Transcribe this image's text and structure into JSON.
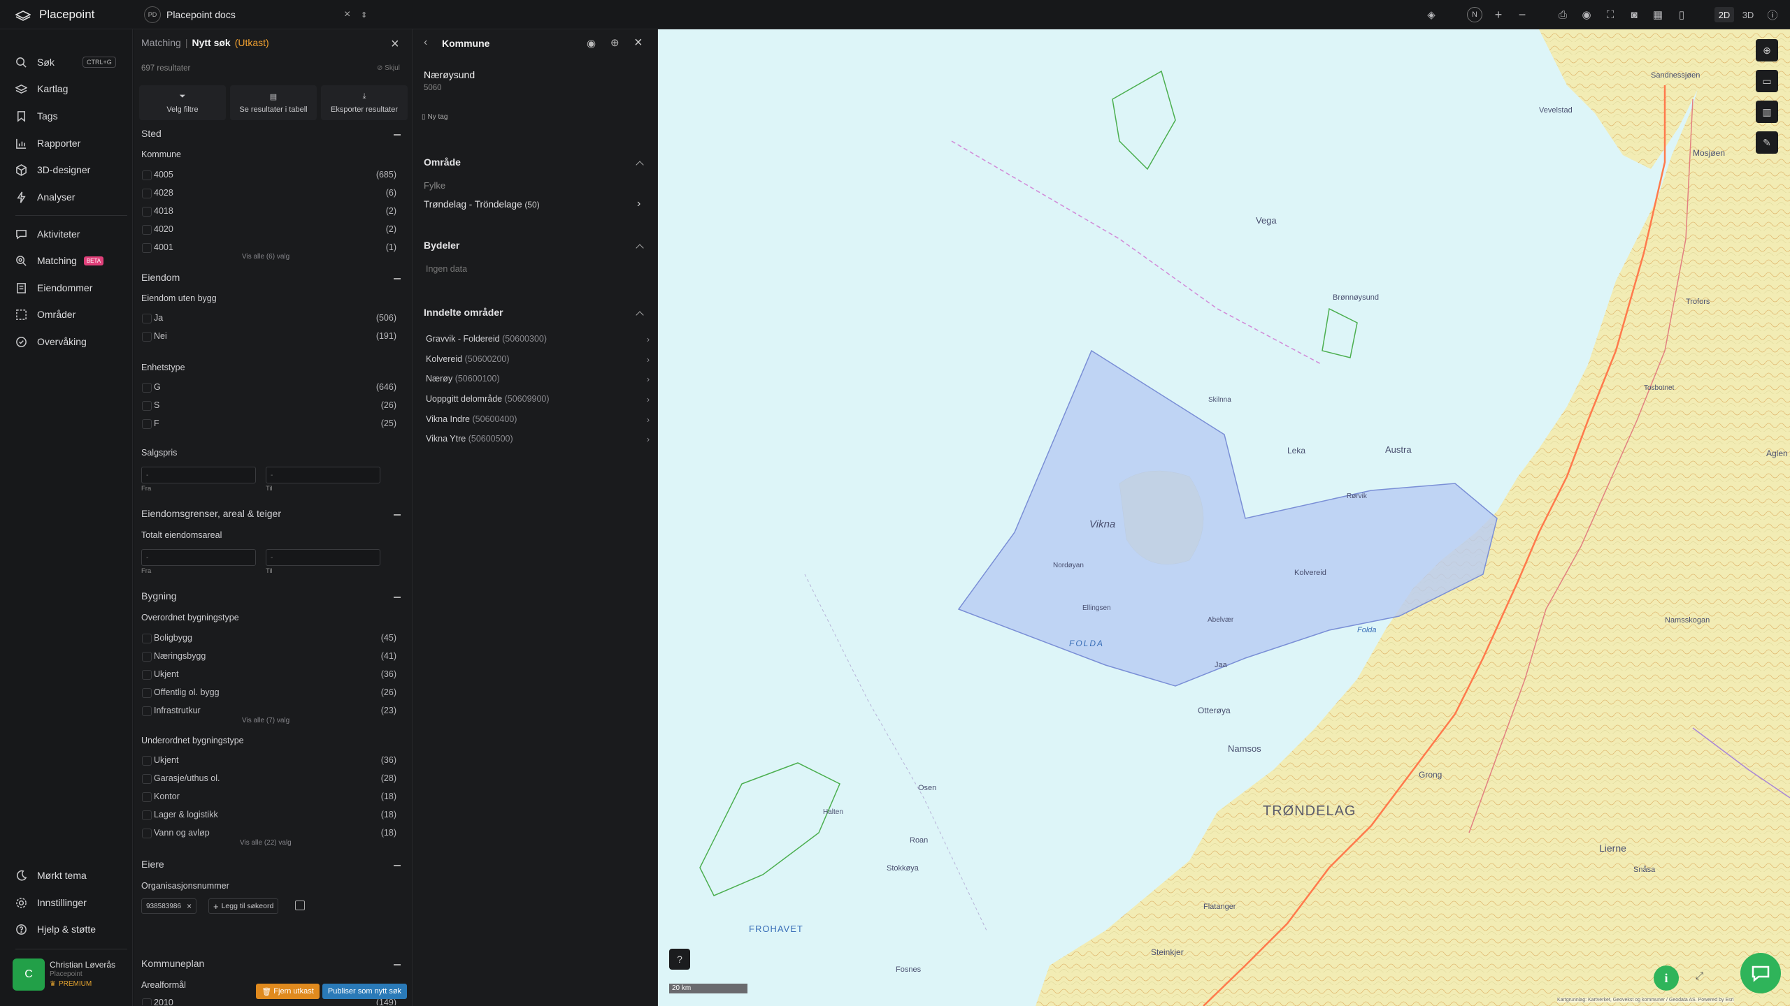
{
  "app": {
    "name": "Placepoint",
    "doc_badge": "PD",
    "doc_title": "Placepoint docs"
  },
  "topbar": {
    "compass": "N",
    "plus": "+",
    "minus": "−",
    "mode_2d": "2D",
    "mode_3d": "3D"
  },
  "sidebar": {
    "items": [
      {
        "label": "Søk",
        "icon": "search-icon",
        "shortcut": "CTRL+G"
      },
      {
        "label": "Kartlag",
        "icon": "layers-icon"
      },
      {
        "label": "Tags",
        "icon": "bookmark-icon"
      },
      {
        "label": "Rapporter",
        "icon": "chart-icon"
      },
      {
        "label": "3D-designer",
        "icon": "cube-icon"
      },
      {
        "label": "Analyser",
        "icon": "bolt-icon"
      },
      {
        "label": "Aktiviteter",
        "icon": "chat-icon"
      },
      {
        "label": "Matching",
        "icon": "matching-icon",
        "badge": "BETA"
      },
      {
        "label": "Eiendommer",
        "icon": "building-icon"
      },
      {
        "label": "Områder",
        "icon": "area-icon"
      },
      {
        "label": "Overvåking",
        "icon": "monitor-icon"
      }
    ],
    "bottom": [
      {
        "label": "Mørkt tema",
        "icon": "moon-icon"
      },
      {
        "label": "Innstillinger",
        "icon": "gear-icon"
      },
      {
        "label": "Hjelp & støtte",
        "icon": "help-icon"
      }
    ],
    "user": {
      "initial": "C",
      "name": "Christian Løverås",
      "org": "Placepoint",
      "tier": "PREMIUM"
    }
  },
  "filter": {
    "crumb": "Matching",
    "separator": "|",
    "title": "Nytt søk",
    "status": "(Utkast)",
    "result_count": "697 resultater",
    "hide_label": "Skjul",
    "actions": [
      "Velg filtre",
      "Se resultater i tabell",
      "Eksporter resultater"
    ],
    "sted": {
      "title": "Sted",
      "kommune_label": "Kommune",
      "kommuner": [
        {
          "l": "4005",
          "c": "(685)"
        },
        {
          "l": "4028",
          "c": "(6)"
        },
        {
          "l": "4018",
          "c": "(2)"
        },
        {
          "l": "4020",
          "c": "(2)"
        },
        {
          "l": "4001",
          "c": "(1)"
        }
      ],
      "show_all": "Vis alle (6) valg"
    },
    "eiendom": {
      "title": "Eiendom",
      "uten_bygg_label": "Eiendom uten bygg",
      "uten_bygg": [
        {
          "l": "Ja",
          "c": "(506)"
        },
        {
          "l": "Nei",
          "c": "(191)"
        }
      ],
      "enhetstype_label": "Enhetstype",
      "enhetstype": [
        {
          "l": "G",
          "c": "(646)"
        },
        {
          "l": "S",
          "c": "(26)"
        },
        {
          "l": "F",
          "c": "(25)"
        }
      ],
      "salgspris_label": "Salgspris",
      "from": "Fra",
      "to": "Til",
      "placeholder": "-"
    },
    "grenser": {
      "title": "Eiendomsgrenser, areal & teiger",
      "areal_label": "Totalt eiendomsareal",
      "from": "Fra",
      "to": "Til",
      "placeholder": "-"
    },
    "bygning": {
      "title": "Bygning",
      "over_label": "Overordnet bygningstype",
      "over": [
        {
          "l": "Boligbygg",
          "c": "(45)"
        },
        {
          "l": "Næringsbygg",
          "c": "(41)"
        },
        {
          "l": "Ukjent",
          "c": "(36)"
        },
        {
          "l": "Offentlig ol. bygg",
          "c": "(26)"
        },
        {
          "l": "Infrastrutkur",
          "c": "(23)"
        }
      ],
      "over_all": "Vis alle (7) valg",
      "under_label": "Underordnet bygningstype",
      "under": [
        {
          "l": "Ukjent",
          "c": "(36)"
        },
        {
          "l": "Garasje/uthus ol.",
          "c": "(28)"
        },
        {
          "l": "Kontor",
          "c": "(18)"
        },
        {
          "l": "Lager & logistikk",
          "c": "(18)"
        },
        {
          "l": "Vann og avløp",
          "c": "(18)"
        }
      ],
      "under_all": "Vis alle (22) valg"
    },
    "eiere": {
      "title": "Eiere",
      "org_label": "Organisasjonsnummer",
      "chip": "938583986",
      "add": "Legg til søkeord"
    },
    "kommuneplan": {
      "title": "Kommuneplan",
      "areal_label": "Arealformål",
      "first": {
        "l": "2010",
        "c": "(149)"
      }
    },
    "btn_remove": "Fjern utkast",
    "btn_publish": "Publiser som nytt søk"
  },
  "detail": {
    "title": "Kommune",
    "name": "Nærøysund",
    "code": "5060",
    "new_tag": "Ny tag",
    "omrade": {
      "title": "Område",
      "fylke_label": "Fylke",
      "fylke": "Trøndelag - Tröndelage",
      "fylke_code": "(50)"
    },
    "bydeler": {
      "title": "Bydeler",
      "empty": "Ingen data"
    },
    "inndelte": {
      "title": "Inndelte områder",
      "items": [
        {
          "l": "Gravvik - Foldereid",
          "c": "(50600300)"
        },
        {
          "l": "Kolvereid",
          "c": "(50600200)"
        },
        {
          "l": "Nærøy",
          "c": "(50600100)"
        },
        {
          "l": "Uoppgitt delområde",
          "c": "(50609900)"
        },
        {
          "l": "Vikna Indre",
          "c": "(50600400)"
        },
        {
          "l": "Vikna Ytre",
          "c": "(50600500)"
        }
      ]
    }
  },
  "map": {
    "labels": [
      "Vikna",
      "Nordøyan",
      "FOLDA",
      "Skilnna",
      "Leka",
      "Austra",
      "Vega",
      "Kolvereid",
      "Rørvik",
      "Abelvær",
      "Jaa",
      "Otterøya",
      "Namsos",
      "TRØNDELAG",
      "FROHAVET",
      "Halten",
      "Lierne",
      "Steinkjer",
      "Grong",
      "Brønnøysund",
      "Mosjøen",
      "Folda",
      "Ellingsen",
      "Tosbotnet",
      "Snåsa",
      "Stokkøya",
      "Roan",
      "Osen",
      "Sandnessjøen",
      "Trofors",
      "Namsskogan",
      "Flatanger",
      "Fosnes",
      "Vevelstad",
      "Aglen"
    ],
    "scale": "20 km",
    "attribution": "Kartgrunnlag: Kartverket, Geovekst og kommuner / Geodata AS. Powered by Esri"
  },
  "colors": {
    "accent": "#f0a030",
    "publish": "#2a7ab8",
    "remove": "#e08a1e",
    "avatar": "#22a048",
    "beta": "#e0407a",
    "sea": "#ddf5f8",
    "selection": "#b8ccf2"
  }
}
